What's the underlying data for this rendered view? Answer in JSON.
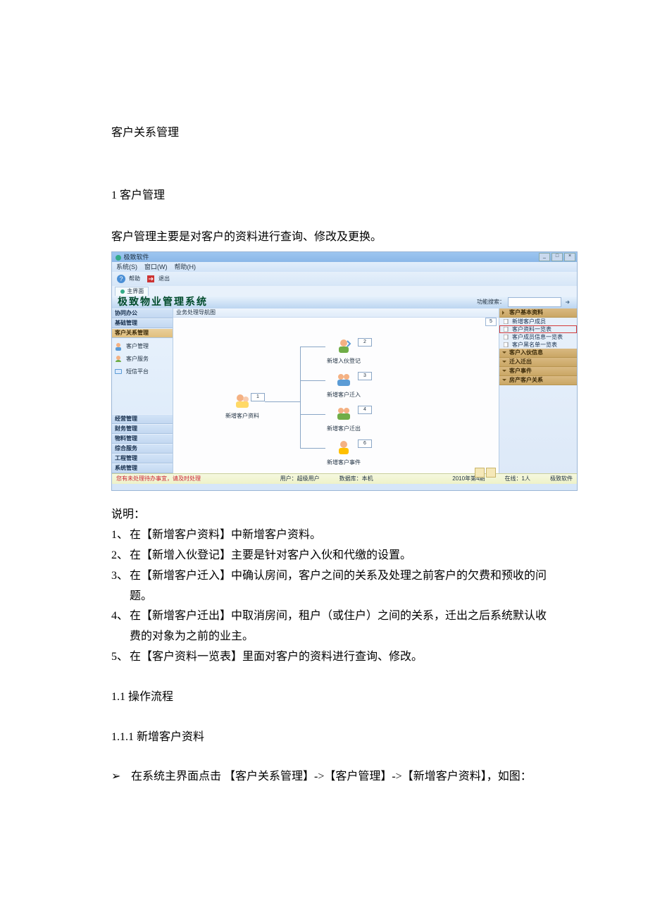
{
  "doc": {
    "title": "客户关系管理",
    "section1_no": "1",
    "section1_title": "客户管理",
    "intro": "客户管理主要是对客户的资料进行查询、修改及更换。",
    "explain_label": "说明：",
    "steps": [
      {
        "n": "1、",
        "t": "在【新增客户资料】中新增客户资料。"
      },
      {
        "n": "2、",
        "t": "在【新增入伙登记】主要是针对客户入伙和代缴的设置。"
      },
      {
        "n": "3、",
        "t": "在【新增客户迁入】中确认房间，客户之间的关系及处理之前客户的欠费和预收的问题。"
      },
      {
        "n": "4、",
        "t": "在【新增客户迁出】中取消房间，租户（或住户）之间的关系，迁出之后系统默认收费的对象为之前的业主。"
      },
      {
        "n": "5、",
        "t": "在【客户资料一览表】里面对客户的资料进行查询、修改。"
      }
    ],
    "sub1_1": "1.1 操作流程",
    "sub1_1_1": "1.1.1 新增客户资料",
    "bullet_sym": "➢",
    "bullet_text": "在系统主界面点击 【客户关系管理】->【客户管理】->【新增客户资料】，如图："
  },
  "app": {
    "window_title": "极致软件",
    "menus": [
      "系统(S)",
      "窗口(W)",
      "帮助(H)"
    ],
    "toolbar": [
      {
        "icon": "help-icon",
        "label": "帮助"
      },
      {
        "icon": "exit-icon",
        "label": "退出"
      }
    ],
    "tab_label": "主界面",
    "system_title": "极致物业管理系统",
    "search_label": "功能搜索：",
    "left_nav_cats_top": [
      "协同办公",
      "基础管理"
    ],
    "left_nav_active": "客户关系管理",
    "left_nav_items": [
      {
        "label": "客户管理",
        "icon": "customer-icon"
      },
      {
        "label": "客户服务",
        "icon": "service-icon"
      },
      {
        "label": "短信平台",
        "icon": "sms-icon"
      }
    ],
    "left_nav_cats_bottom": [
      "经营管理",
      "财务管理",
      "物料管理",
      "综合服务",
      "工程管理",
      "系统管理"
    ],
    "canvas_header": "业务处理导航图",
    "nodes": {
      "root": {
        "label": "新增客户资料",
        "num": "1"
      },
      "n2": {
        "label": "新增入伙登记",
        "num": "2"
      },
      "n3": {
        "label": "新增客户迁入",
        "num": "3"
      },
      "n4": {
        "label": "新增客户迁出",
        "num": "4"
      },
      "n6": {
        "label": "新增客户事件",
        "num": "6"
      }
    },
    "right_pane": {
      "group1": {
        "title": "客户基本资料",
        "num": "5",
        "items": [
          "新增客户成员",
          "客户资料一览表",
          "客户成员信息一览表",
          "客户黑名单一览表"
        ]
      },
      "groups_collapsed": [
        "客户入伙信息",
        "迁入迁出",
        "客户事件",
        "房产客户关系"
      ]
    },
    "statusbar": {
      "alert": "您有未处理待办事宜，请及时处理",
      "user_label": "用户：超级用户",
      "db_label": "数据库：本机",
      "period": "2010年第4期",
      "online": "在线：1人",
      "brand": "极致软件"
    },
    "win_buttons": [
      "_",
      "□",
      "×"
    ]
  }
}
